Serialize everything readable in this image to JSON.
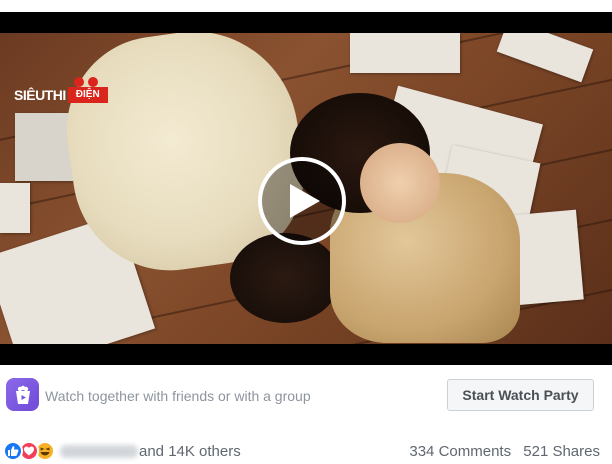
{
  "video": {
    "logo_text": "SIÊUTHI",
    "logo_badge": "ĐIỆN",
    "play_icon": "play-icon"
  },
  "watch_party": {
    "icon": "watch-party-icon",
    "prompt": "Watch together with friends or with a group",
    "button_label": "Start Watch Party"
  },
  "reactions": {
    "icons": [
      "like-reaction-icon",
      "love-reaction-icon",
      "haha-reaction-icon"
    ],
    "others_text": "and 14K others",
    "comments": "334 Comments",
    "shares": "521 Shares"
  },
  "colors": {
    "accent": "#1877f2",
    "love": "#f33e58",
    "haha": "#f7b125",
    "watch_party": "#7b57e0"
  }
}
